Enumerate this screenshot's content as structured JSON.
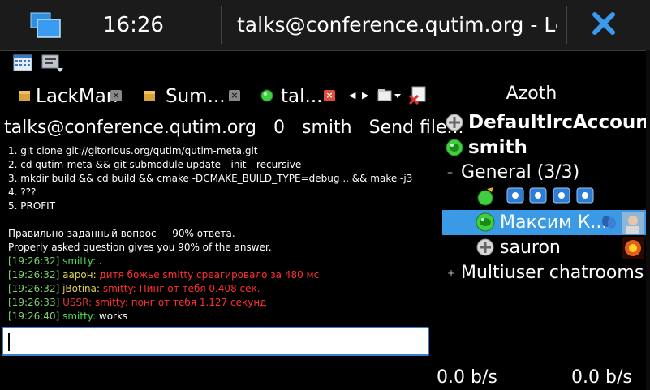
{
  "statusbar": {
    "time": "16:26",
    "window_title": "talks@conference.qutim.org - LeechCraft"
  },
  "icons": {
    "task_switcher": "task-switcher-icon",
    "close": "close-icon",
    "calendar": "calendar-icon",
    "keyboard": "keyboard-icon"
  },
  "tabs": [
    {
      "label": "LackMan",
      "icon": "package-icon"
    },
    {
      "label": "Sum...",
      "icon": "package-icon"
    },
    {
      "label": "tal...",
      "icon": "online-status-icon"
    }
  ],
  "chat": {
    "room": "talks@conference.qutim.org",
    "count": "0",
    "nick": "smith",
    "send_file": "Send file...",
    "lines": [
      {
        "text": "1. git clone git://gitorious.org/qutim/qutim-meta.git"
      },
      {
        "text": "2. cd qutim-meta && git submodule update --init --recursive"
      },
      {
        "text": "3. mkdir build && cd build && cmake  -DCMAKE_BUILD_TYPE=debug .. && make -j3"
      },
      {
        "text": "4. ???"
      },
      {
        "text": "5. PROFIT"
      },
      {
        "text": ""
      },
      {
        "text": "Правильно заданный вопрос — 90% ответа."
      },
      {
        "text": "Properly asked question gives you 90% of the answer."
      }
    ],
    "messages": [
      {
        "time": "[19:26:32]",
        "nick": "smitty",
        "sep": ":",
        "text": " .",
        "nick_color": "g",
        "text_color": "w"
      },
      {
        "time": "[19:26:32]",
        "nick": "аарон",
        "sep": ":",
        "text": " дитя божье smitty среагировало за 480 мс",
        "nick_color": "y",
        "text_color": "r"
      },
      {
        "time": "[19:26:32]",
        "nick": "jBotina",
        "sep": ":",
        "text": " smitty: Пинг от тебя 0.408 сек.",
        "nick_color": "y",
        "text_color": "r"
      },
      {
        "time": "[19:26:33]",
        "nick": "USSR",
        "sep": ":",
        "text": " smitty: понг от тебя 1.127 секунд",
        "nick_color": "r",
        "text_color": "r"
      },
      {
        "time": "[19:26:40]",
        "nick": "smitty",
        "sep": ":",
        "text": " works",
        "nick_color": "g",
        "text_color": "w"
      }
    ],
    "input_value": ""
  },
  "roster": {
    "title": "Azoth",
    "account1": "DefaultIrcAccount",
    "account2": "smith",
    "group_general": "General (3/3)",
    "contact_selected": "Максим К...",
    "contact_sauron": "sauron",
    "group_muc": "Multiuser chatrooms (",
    "expander_open": "–",
    "expander_closed": "+"
  },
  "traffic": {
    "down": "0.0 b/s",
    "up": "0.0 b/s"
  },
  "colors": {
    "accent": "#3a8ee6",
    "selection": "#3a9ae6",
    "timestamp": "#7ccf6b",
    "online": "#3fcf3f",
    "error_text": "#ff3030"
  }
}
